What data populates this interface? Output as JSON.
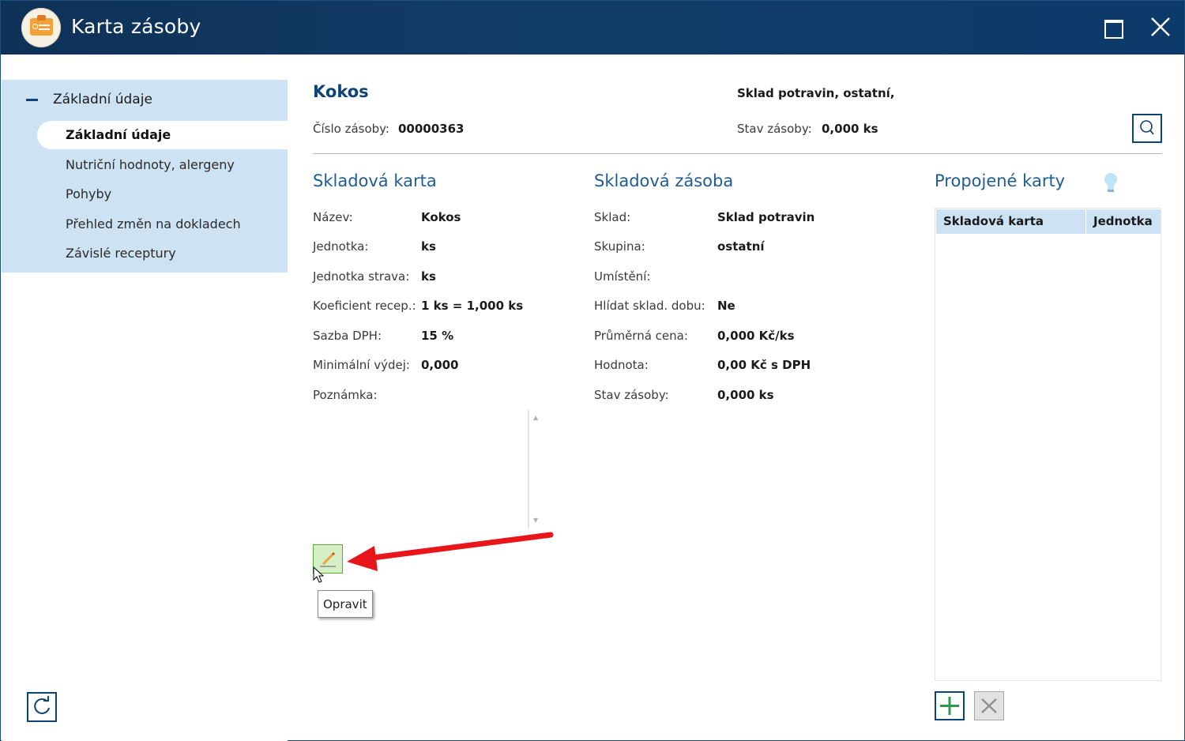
{
  "window": {
    "title": "Karta zásoby",
    "accent_color": "#0d4477",
    "titlebar_color": "#0e3157"
  },
  "sidebar": {
    "group_label": "Základní údaje",
    "items": [
      {
        "label": "Základní údaje",
        "active": true
      },
      {
        "label": "Nutriční hodnoty, alergeny",
        "active": false
      },
      {
        "label": "Pohyby",
        "active": false
      },
      {
        "label": "Přehled změn na dokladech",
        "active": false
      },
      {
        "label": "Závislé receptury",
        "active": false
      }
    ]
  },
  "header": {
    "item_name": "Kokos",
    "warehouse_summary": "Sklad potravin, ostatní,",
    "stock_number_label": "Číslo zásoby:",
    "stock_number_value": "00000363",
    "stock_state_label": "Stav zásoby:",
    "stock_state_value": "0,000 ks"
  },
  "stock_card": {
    "title": "Skladová karta",
    "fields": [
      {
        "label": "Název:",
        "value": "Kokos"
      },
      {
        "label": "Jednotka:",
        "value": "ks"
      },
      {
        "label": "Jednotka strava:",
        "value": "ks"
      },
      {
        "label": "Koeficient recep.:",
        "value": "1 ks = 1,000 ks"
      },
      {
        "label": "Sazba DPH:",
        "value": "15 %"
      },
      {
        "label": "Minimální výdej:",
        "value": "0,000"
      },
      {
        "label": "Poznámka:",
        "value": ""
      }
    ]
  },
  "stock_supply": {
    "title": "Skladová zásoba",
    "fields": [
      {
        "label": "Sklad:",
        "value": "Sklad potravin"
      },
      {
        "label": "Skupina:",
        "value": "ostatní"
      },
      {
        "label": "Umístění:",
        "value": ""
      },
      {
        "label": "Hlídat sklad. dobu:",
        "value": "Ne"
      },
      {
        "label": "Průměrná cena:",
        "value": "0,000 Kč/ks"
      },
      {
        "label": "Hodnota:",
        "value": "0,00 Kč s DPH"
      },
      {
        "label": "Stav zásoby:",
        "value": "0,000 ks"
      }
    ]
  },
  "linked_cards": {
    "title": "Propojené karty",
    "columns": [
      "Skladová karta",
      "Jednotka"
    ]
  },
  "edit": {
    "tooltip": "Opravit"
  }
}
